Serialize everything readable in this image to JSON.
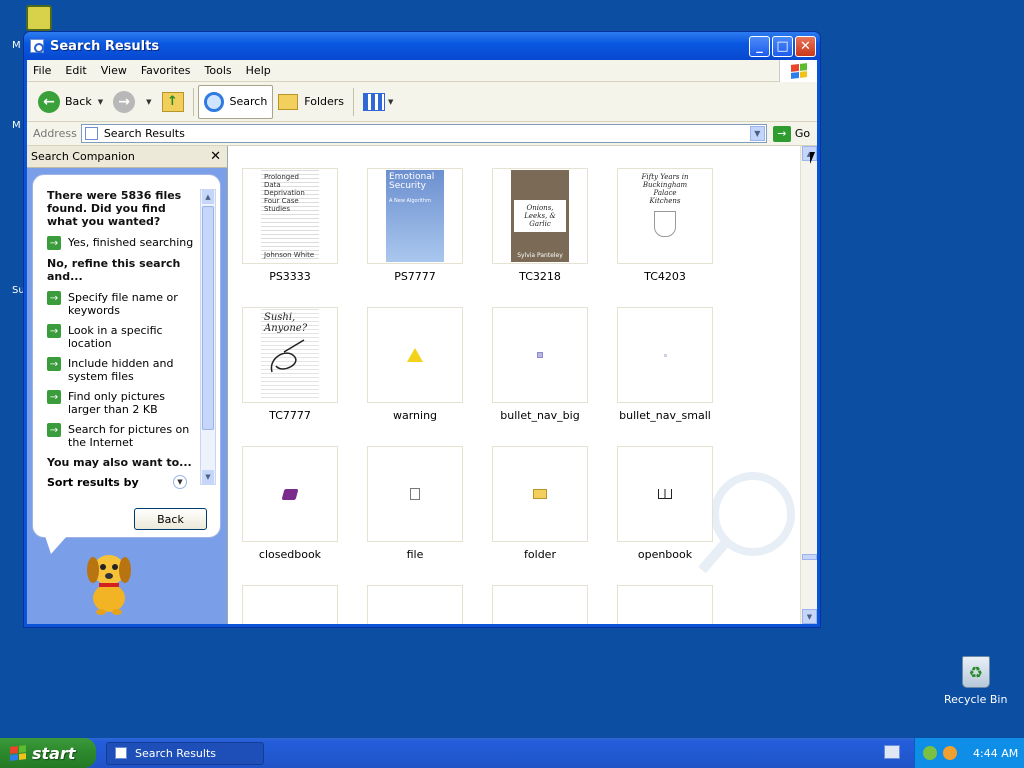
{
  "window": {
    "title": "Search Results",
    "menu": [
      "File",
      "Edit",
      "View",
      "Favorites",
      "Tools",
      "Help"
    ],
    "toolbar": {
      "back": "Back",
      "search": "Search",
      "folders": "Folders"
    },
    "address": {
      "label": "Address",
      "value": "Search Results",
      "go": "Go"
    }
  },
  "companion": {
    "header": "Search Companion",
    "close_icon": "close-icon",
    "question": "There were 5836 files found. Did you find what you wanted?",
    "yes_option": "Yes, finished searching",
    "refine_heading": "No, refine this search and...",
    "refine_options": [
      "Specify file name or keywords",
      "Look in a specific location",
      "Include hidden and system files",
      "Find only pictures larger than 2 KB",
      "Search for pictures on the Internet"
    ],
    "also_heading": "You may also want to...",
    "sort_label": "Sort results by",
    "back_button": "Back"
  },
  "results": [
    {
      "name": "PS3333",
      "cover_text": "Prolonged Data Deprivation Four Case Studies",
      "cover_author": "Johnson White"
    },
    {
      "name": "PS7777",
      "cover_text": "Emotional Security",
      "cover_sub": "A New Algorithm"
    },
    {
      "name": "TC3218",
      "cover_text": "Onions, Leeks, & Garlic",
      "cover_author": "Sylvia Panteley"
    },
    {
      "name": "TC4203",
      "cover_text": "Fifty Years in Buckingham Palace Kitchens"
    },
    {
      "name": "TC7777",
      "cover_text": "Sushi, Anyone?"
    },
    {
      "name": "warning"
    },
    {
      "name": "bullet_nav_big"
    },
    {
      "name": "bullet_nav_small"
    },
    {
      "name": "closedbook"
    },
    {
      "name": "file"
    },
    {
      "name": "folder"
    },
    {
      "name": "openbook"
    }
  ],
  "desktop": {
    "recycle_bin": "Recycle Bin"
  },
  "taskbar": {
    "start": "start",
    "task": "Search Results",
    "clock": "4:44 AM"
  }
}
